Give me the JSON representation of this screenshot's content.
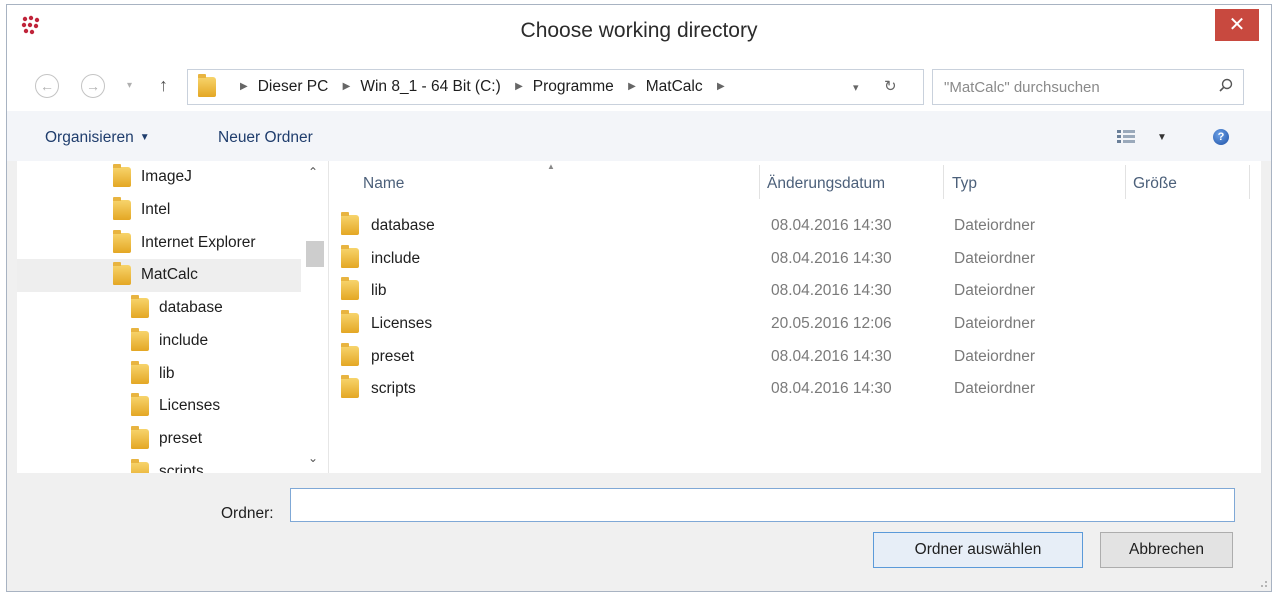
{
  "window": {
    "title": "Choose working directory",
    "close_glyph": "✕"
  },
  "nav": {
    "back_glyph": "←",
    "forward_glyph": "→",
    "recent_glyph": "▾",
    "up_glyph": "↑",
    "breadcrumb": [
      "Dieser PC",
      "Win 8_1 - 64 Bit (C:)",
      "Programme",
      "MatCalc"
    ],
    "dropdown_glyph": "▾",
    "refresh_glyph": "↻"
  },
  "search": {
    "placeholder": "\"MatCalc\" durchsuchen"
  },
  "toolbar": {
    "organize_label": "Organisieren",
    "new_folder_label": "Neuer Ordner",
    "help_glyph": "?"
  },
  "tree": {
    "items": [
      {
        "label": "ImageJ",
        "indent": 1,
        "selected": false
      },
      {
        "label": "Intel",
        "indent": 1,
        "selected": false
      },
      {
        "label": "Internet Explorer",
        "indent": 1,
        "selected": false
      },
      {
        "label": "MatCalc",
        "indent": 1,
        "selected": true
      },
      {
        "label": "database",
        "indent": 2,
        "selected": false
      },
      {
        "label": "include",
        "indent": 2,
        "selected": false
      },
      {
        "label": "lib",
        "indent": 2,
        "selected": false
      },
      {
        "label": "Licenses",
        "indent": 2,
        "selected": false
      },
      {
        "label": "preset",
        "indent": 2,
        "selected": false
      },
      {
        "label": "scripts",
        "indent": 2,
        "selected": false
      }
    ]
  },
  "filelist": {
    "columns": {
      "name": "Name",
      "date": "Änderungsdatum",
      "type": "Typ",
      "size": "Größe"
    },
    "rows": [
      {
        "name": "database",
        "date": "08.04.2016 14:30",
        "type": "Dateiordner"
      },
      {
        "name": "include",
        "date": "08.04.2016 14:30",
        "type": "Dateiordner"
      },
      {
        "name": "lib",
        "date": "08.04.2016 14:30",
        "type": "Dateiordner"
      },
      {
        "name": "Licenses",
        "date": "20.05.2016 12:06",
        "type": "Dateiordner"
      },
      {
        "name": "preset",
        "date": "08.04.2016 14:30",
        "type": "Dateiordner"
      },
      {
        "name": "scripts",
        "date": "08.04.2016 14:30",
        "type": "Dateiordner"
      }
    ]
  },
  "footer": {
    "folder_label": "Ordner:",
    "folder_value": "",
    "select_button": "Ordner auswählen",
    "cancel_button": "Abbrechen"
  },
  "colors": {
    "close_button": "#c8493f",
    "link_text": "#1f3d6d",
    "primary_button_border": "#5b9ad9"
  }
}
